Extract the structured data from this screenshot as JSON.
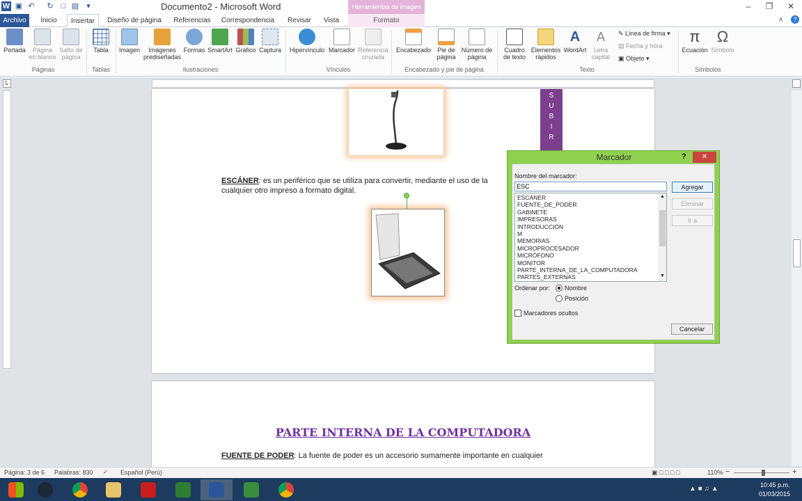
{
  "window": {
    "title": "Documento2 - Microsoft Word",
    "context_tab": "Herramientas de imagen",
    "minimize": "–",
    "restore": "❐",
    "close": "✕"
  },
  "tabs": [
    "Archivo",
    "Inicio",
    "Insertar",
    "Diseño de página",
    "Referencias",
    "Correspondencia",
    "Revisar",
    "Vista",
    "Formato"
  ],
  "ribbon": {
    "paginas": {
      "group": "Páginas",
      "portada": "Portada",
      "pagina_blanco": "Página\nen blanco",
      "salto": "Salto de\npágina"
    },
    "tablas": {
      "group": "Tablas",
      "tabla": "Tabla"
    },
    "ilustraciones": {
      "group": "Ilustraciones",
      "imagen": "Imagen",
      "predis": "Imágenes\nprediseñadas",
      "formas": "Formas",
      "smartart": "SmartArt",
      "grafico": "Gráfico",
      "captura": "Captura"
    },
    "vinculos": {
      "group": "Vínculos",
      "hipervinculo": "Hipervínculo",
      "marcador": "Marcador",
      "referencia": "Referencia\ncruzada"
    },
    "encab": {
      "group": "Encabezado y pie de página",
      "encabezado": "Encabezado",
      "pie": "Pie de\npágina",
      "numero": "Número de\npágina"
    },
    "texto": {
      "group": "Texto",
      "cuadro": "Cuadro\nde texto",
      "elementos": "Elementos\nrápidos",
      "wordart": "WordArt",
      "letra": "Letra\ncapital",
      "linea_firma": "Línea de firma",
      "fecha": "Fecha y hora",
      "objeto": "Objeto"
    },
    "simbolos": {
      "group": "Símbolos",
      "ecuacion": "Ecuación",
      "simbolo": "Símbolo"
    }
  },
  "document": {
    "escaner_label": "ESCÁNER",
    "escaner_text": ": es un periférico que se utiliza para convertir, mediante el uso de la",
    "escaner_text2": "cualquier otro impreso a formato digital.",
    "subir_letters": [
      "S",
      "U",
      "B",
      "I",
      "R"
    ],
    "heading": "PARTE INTERNA DE LA COMPUTADORA",
    "fuente_label": "FUENTE DE PODER",
    "fuente_text": ": La fuente de poder es un accesorio sumamente importante en cualquier"
  },
  "dialog": {
    "title": "Marcador",
    "help": "?",
    "close": "✕",
    "name_label": "Nombre del marcador:",
    "name_value": "ESC",
    "bookmarks": [
      "ESCÁNER",
      "FUENTE_DE_PODER",
      "GABINETE",
      "IMPRESORAS",
      "INTRODUCCIÓN",
      "M",
      "MEMORIAS",
      "MICROPROCESADOR",
      "MICRÓFONO",
      "MONITOR",
      "PARTE_INTERNA_DE_LA_COMPUTADORA",
      "PARTES_EXTERNAS"
    ],
    "btn_agregar": "Agregar",
    "btn_eliminar": "Eliminar",
    "btn_ira": "Ir a",
    "order_label": "Ordenar por:",
    "order_nombre": "Nombre",
    "order_posicion": "Posición",
    "hidden_label": "Marcadores ocultos",
    "btn_cancelar": "Cancelar"
  },
  "status": {
    "page": "Página: 3 de 6",
    "words": "Palabras: 830",
    "lang": "Español (Perú)",
    "zoom": "110%"
  },
  "taskbar": {
    "time": "10:45 p.m.",
    "date": "01/03/2015"
  },
  "colors": {
    "accent": "#2b5797",
    "dialog_frame": "#8fd14f",
    "heading": "#7030a0",
    "image_glow": "#f7c89b",
    "subir_bg": "#7b3f8e"
  }
}
